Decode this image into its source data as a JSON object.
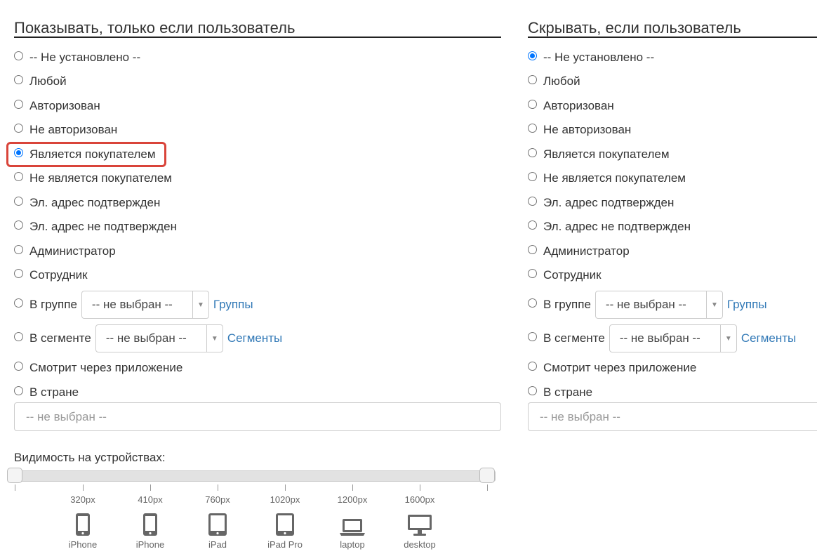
{
  "left": {
    "title": "Показывать, только если пользователь",
    "options": [
      {
        "label": "-- Не установлено --",
        "checked": false
      },
      {
        "label": "Любой",
        "checked": false
      },
      {
        "label": "Авторизован",
        "checked": false
      },
      {
        "label": "Не авторизован",
        "checked": false
      },
      {
        "label": "Является покупателем",
        "checked": true
      },
      {
        "label": "Не является покупателем",
        "checked": false
      },
      {
        "label": "Эл. адрес подтвержден",
        "checked": false
      },
      {
        "label": "Эл. адрес не подтвержден",
        "checked": false
      },
      {
        "label": "Администратор",
        "checked": false
      },
      {
        "label": "Сотрудник",
        "checked": false
      }
    ],
    "group": {
      "label": "В группе",
      "select": "-- не выбран --",
      "link": "Группы"
    },
    "segment": {
      "label": "В сегменте",
      "select": "-- не выбран --",
      "link": "Сегменты"
    },
    "app": {
      "label": "Смотрит через приложение"
    },
    "country": {
      "label": "В стране",
      "placeholder": "-- не выбран --"
    }
  },
  "right": {
    "title": "Скрывать, если пользователь",
    "options": [
      {
        "label": "-- Не установлено --",
        "checked": true
      },
      {
        "label": "Любой",
        "checked": false
      },
      {
        "label": "Авторизован",
        "checked": false
      },
      {
        "label": "Не авторизован",
        "checked": false
      },
      {
        "label": "Является покупателем",
        "checked": false
      },
      {
        "label": "Не является покупателем",
        "checked": false
      },
      {
        "label": "Эл. адрес подтвержден",
        "checked": false
      },
      {
        "label": "Эл. адрес не подтвержден",
        "checked": false
      },
      {
        "label": "Администратор",
        "checked": false
      },
      {
        "label": "Сотрудник",
        "checked": false
      }
    ],
    "group": {
      "label": "В группе",
      "select": "-- не выбран --",
      "link": "Группы"
    },
    "segment": {
      "label": "В сегменте",
      "select": "-- не выбран --",
      "link": "Сегменты"
    },
    "app": {
      "label": "Смотрит через приложение"
    },
    "country": {
      "label": "В стране",
      "placeholder": "-- не выбран --"
    }
  },
  "devices": {
    "title": "Видимость на устройствах:",
    "items": [
      {
        "px": "320px",
        "name": "iPhone",
        "icon": "phone-icon"
      },
      {
        "px": "410px",
        "name": "iPhone",
        "icon": "phone-icon"
      },
      {
        "px": "760px",
        "name": "iPad",
        "icon": "tablet-icon"
      },
      {
        "px": "1020px",
        "name": "iPad Pro",
        "icon": "tablet-icon"
      },
      {
        "px": "1200px",
        "name": "laptop",
        "icon": "laptop-icon"
      },
      {
        "px": "1600px",
        "name": "desktop",
        "icon": "desktop-icon"
      }
    ]
  },
  "colors": {
    "accent": "#0075ff",
    "link": "#337ab7",
    "highlight": "#d9443a"
  }
}
